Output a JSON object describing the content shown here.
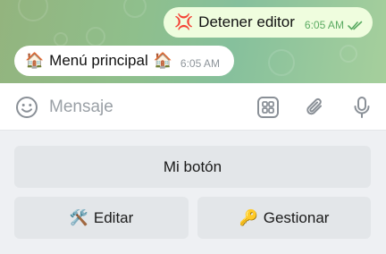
{
  "messages": [
    {
      "direction": "out",
      "emoji": "💢",
      "text": "Detener editor",
      "time": "6:05 AM",
      "status": "read"
    },
    {
      "direction": "in",
      "emoji_start": "🏠",
      "text": "Menú principal",
      "emoji_end": "🏠",
      "time": "6:05 AM"
    }
  ],
  "composer": {
    "placeholder": "Mensaje",
    "icons": [
      "emoji-icon",
      "bot-keyboard-icon",
      "attach-icon",
      "microphone-icon"
    ]
  },
  "keyboard": {
    "rows": [
      [
        {
          "label": "Mi botón"
        }
      ],
      [
        {
          "emoji": "🛠️",
          "label": "Editar"
        },
        {
          "emoji": "🔑",
          "label": "Gestionar"
        }
      ]
    ]
  },
  "colors": {
    "outgoing_bubble": "#effdde",
    "incoming_bubble": "#ffffff",
    "read_ticks": "#5bab62",
    "keyboard_button": "#e3e6e9",
    "icon_gray": "#8a9097"
  }
}
